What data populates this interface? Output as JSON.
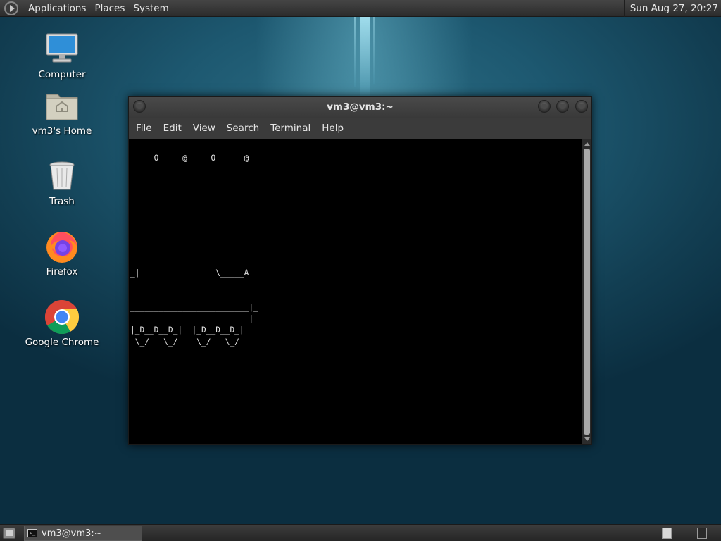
{
  "top_panel": {
    "menus": [
      "Applications",
      "Places",
      "System"
    ],
    "clock": "Sun Aug 27, 20:27"
  },
  "desktop_icons": [
    {
      "label": "Computer",
      "icon": "computer-icon"
    },
    {
      "label": "vm3's Home",
      "icon": "home-folder-icon"
    },
    {
      "label": "Trash",
      "icon": "trash-icon"
    },
    {
      "label": "Firefox",
      "icon": "firefox-icon"
    },
    {
      "label": "Google Chrome",
      "icon": "chrome-icon"
    }
  ],
  "window": {
    "title": "vm3@vm3:~",
    "menus": [
      "File",
      "Edit",
      "View",
      "Search",
      "Terminal",
      "Help"
    ],
    "terminal_text": "     O     @     O      @\n\n\n\n\n\n\n\n\n ________________\n_|                \\_____A\n                          |\n                          |\n_________________________|_\n_________________________|_\n|_D__D__D_|  |_D__D__D_|\n \\_/   \\_/    \\_/   \\_/"
  },
  "taskbar": {
    "task_label": "vm3@vm3:~"
  }
}
